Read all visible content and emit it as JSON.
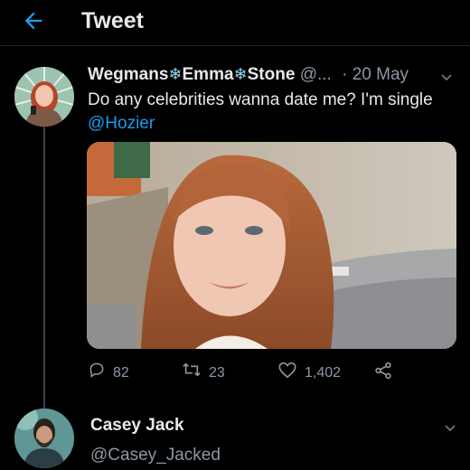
{
  "header": {
    "title": "Tweet",
    "back_icon": "arrow-left-icon",
    "accent": "#1d9bf0"
  },
  "tweet": {
    "name_parts": [
      "Wegmans",
      "Emma",
      "Stone"
    ],
    "snowflake": "❄",
    "handle": "@...",
    "separator": "·",
    "date": "20 May",
    "text": "Do any celebrities wanna date me? I'm single",
    "mention": "@Hozier",
    "actions": {
      "replies": "82",
      "retweets": "23",
      "likes": "1,402"
    }
  },
  "reply": {
    "name": "Casey Jack",
    "handle": "@Casey_Jacked"
  }
}
